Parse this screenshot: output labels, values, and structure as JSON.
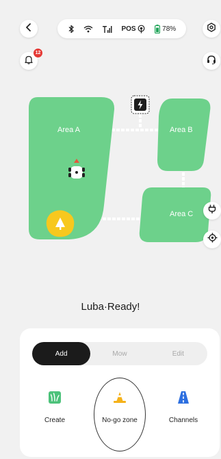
{
  "header": {
    "back_icon": "chevron-left-icon",
    "settings_icon": "settings-icon",
    "status": {
      "bluetooth_icon": "bluetooth-icon",
      "wifi_icon": "wifi-icon",
      "cellular_icon": "cellular-signal-icon",
      "pos_label": "POS",
      "pos_icon": "positioning-signal-icon",
      "battery_icon": "battery-icon",
      "battery_percent": "78%"
    },
    "notifications_count": "12",
    "support_icon": "headset-icon"
  },
  "map": {
    "areas": [
      {
        "label": "Area A"
      },
      {
        "label": "Area B"
      },
      {
        "label": "Area C"
      }
    ],
    "charging_station_icon": "charging-station-icon",
    "robot_icon": "mower-robot-icon",
    "nogo_zone_icon": "tree-icon",
    "charger_button_icon": "charger-plug-icon",
    "locate_button_icon": "locate-crosshair-icon",
    "colors": {
      "lawn": "#6dd18b",
      "nogo": "#f7c81e",
      "path": "#ffffff"
    }
  },
  "device_status": "Luba·Ready!",
  "panel": {
    "tabs": [
      {
        "label": "Add",
        "active": true
      },
      {
        "label": "Mow",
        "active": false
      },
      {
        "label": "Edit",
        "active": false
      }
    ],
    "actions": [
      {
        "label": "Create",
        "icon": "grass-area-icon"
      },
      {
        "label": "No-go zone",
        "icon": "traffic-cone-icon"
      },
      {
        "label": "Channels",
        "icon": "road-channel-icon"
      }
    ]
  }
}
